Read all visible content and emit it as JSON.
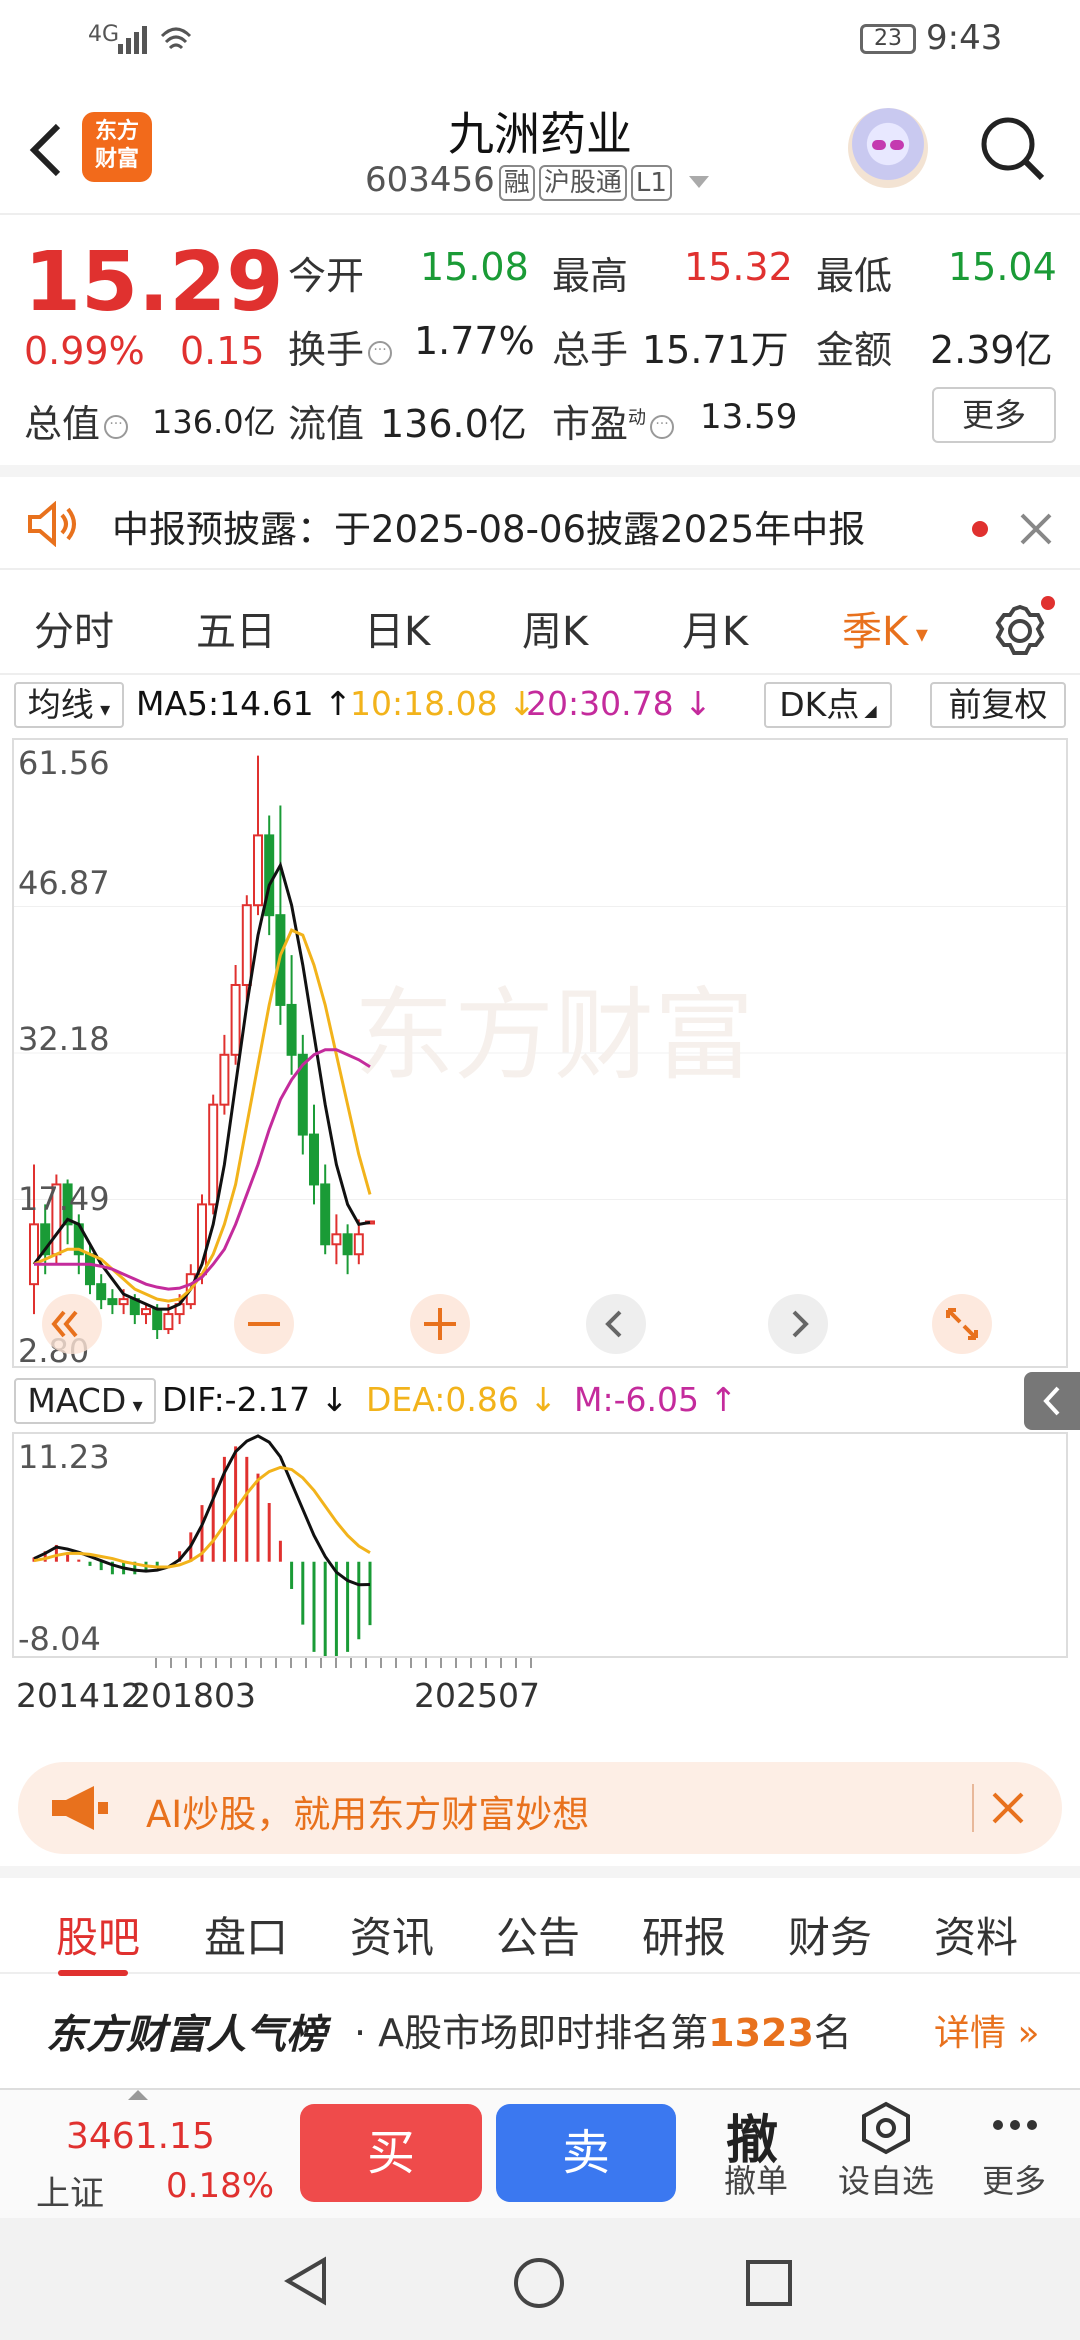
{
  "status": {
    "signal": "4G",
    "battery": "23",
    "time": "9:43"
  },
  "header": {
    "title": "九洲药业",
    "code": "603456",
    "tags": [
      "融",
      "沪股通",
      "L1"
    ],
    "logo_line1": "东方",
    "logo_line2": "财富"
  },
  "quote": {
    "price": "15.29",
    "pct": "0.99%",
    "change": "0.15",
    "open_label": "今开",
    "open": "15.08",
    "high_label": "最高",
    "high": "15.32",
    "low_label": "最低",
    "low": "15.04",
    "turnover_label": "换手",
    "turnover": "1.77%",
    "volume_label": "总手",
    "volume": "15.71万",
    "amount_label": "金额",
    "amount": "2.39亿",
    "mktcap_label": "总值",
    "mktcap": "136.0亿",
    "float_label": "流值",
    "float": "136.0亿",
    "pe_label": "市盈",
    "pe_sup": "动",
    "pe": "13.59",
    "more": "更多"
  },
  "notice": {
    "text": "中报预披露：于2025-08-06披露2025年中报"
  },
  "period_tabs": [
    "分时",
    "五日",
    "日K",
    "周K",
    "月K",
    "季K"
  ],
  "ma_row": {
    "indicator": "均线",
    "ma5": "MA5:14.61",
    "ma10": "10:18.08",
    "ma20": "20:30.78",
    "dk": "DK点",
    "adjust": "前复权"
  },
  "colors": {
    "up": "#e0312f",
    "down": "#1a9b36",
    "ma5": "#111111",
    "ma10": "#f2b31b",
    "ma20": "#c42b9c",
    "accent": "#e8711d"
  },
  "chart_data": [
    {
      "type": "candlestick",
      "title": "",
      "y_ticks": [
        "61.56",
        "46.87",
        "32.18",
        "17.49",
        "2.80"
      ],
      "ylim": [
        2.8,
        61.56
      ],
      "x_labels": [
        "201412",
        "201803",
        "202507"
      ],
      "series": [
        {
          "name": "MA5",
          "values": [
            11,
            12.5,
            14,
            15.5,
            15,
            13,
            11,
            9.5,
            8,
            7.5,
            7,
            6.5,
            6.5,
            7,
            8.5,
            11,
            15,
            21,
            29,
            37,
            44,
            49,
            51,
            47,
            41,
            34,
            27,
            21,
            17,
            15,
            15.2
          ]
        },
        {
          "name": "MA10",
          "values": [
            11,
            11.5,
            12,
            12.5,
            12.5,
            12,
            11.5,
            10.5,
            9.5,
            8.5,
            8,
            7.5,
            7.3,
            7.5,
            8.5,
            10,
            12,
            15,
            19,
            25,
            31,
            37,
            42,
            44.5,
            44,
            41,
            37,
            32,
            27,
            22,
            18
          ]
        },
        {
          "name": "MA20",
          "values": [
            11,
            11,
            11,
            11,
            11,
            11,
            10.8,
            10.5,
            10,
            9.5,
            9,
            8.7,
            8.5,
            8.6,
            9,
            9.7,
            11,
            12.5,
            15,
            18,
            21,
            24.5,
            27.5,
            29.5,
            31,
            32,
            32.5,
            32.5,
            32,
            31.5,
            30.8
          ]
        }
      ],
      "candles": [
        {
          "o": 9,
          "c": 15,
          "h": 21,
          "l": 6
        },
        {
          "o": 15,
          "c": 12,
          "h": 17,
          "l": 10
        },
        {
          "o": 12,
          "c": 19,
          "h": 20,
          "l": 11
        },
        {
          "o": 19,
          "c": 15,
          "h": 19.5,
          "l": 13
        },
        {
          "o": 15,
          "c": 12,
          "h": 16,
          "l": 10
        },
        {
          "o": 12,
          "c": 9,
          "h": 13,
          "l": 8
        },
        {
          "o": 9,
          "c": 7.5,
          "h": 10,
          "l": 6.5
        },
        {
          "o": 7.5,
          "c": 7,
          "h": 8.5,
          "l": 6
        },
        {
          "o": 7,
          "c": 7.5,
          "h": 8.5,
          "l": 6
        },
        {
          "o": 7.5,
          "c": 6,
          "h": 8,
          "l": 5
        },
        {
          "o": 6,
          "c": 6.5,
          "h": 7,
          "l": 5
        },
        {
          "o": 6.5,
          "c": 4.5,
          "h": 7,
          "l": 3.5
        },
        {
          "o": 4.5,
          "c": 6,
          "h": 7,
          "l": 4
        },
        {
          "o": 6,
          "c": 7,
          "h": 8,
          "l": 5
        },
        {
          "o": 7,
          "c": 10,
          "h": 11,
          "l": 6.5
        },
        {
          "o": 10,
          "c": 17,
          "h": 18,
          "l": 9
        },
        {
          "o": 17,
          "c": 27,
          "h": 28,
          "l": 16
        },
        {
          "o": 27,
          "c": 32,
          "h": 34,
          "l": 26
        },
        {
          "o": 32,
          "c": 39,
          "h": 41,
          "l": 31
        },
        {
          "o": 39,
          "c": 47,
          "h": 48,
          "l": 37
        },
        {
          "o": 47,
          "c": 54,
          "h": 62,
          "l": 46
        },
        {
          "o": 54,
          "c": 46,
          "h": 56,
          "l": 44
        },
        {
          "o": 46,
          "c": 37,
          "h": 57,
          "l": 35
        },
        {
          "o": 37,
          "c": 32,
          "h": 42,
          "l": 30
        },
        {
          "o": 32,
          "c": 24,
          "h": 34,
          "l": 22
        },
        {
          "o": 24,
          "c": 19,
          "h": 27,
          "l": 17
        },
        {
          "o": 19,
          "c": 13,
          "h": 21,
          "l": 12
        },
        {
          "o": 13,
          "c": 14,
          "h": 16,
          "l": 11
        },
        {
          "o": 14,
          "c": 12,
          "h": 15,
          "l": 10
        },
        {
          "o": 12,
          "c": 14,
          "h": 15.5,
          "l": 11
        },
        {
          "o": 15.08,
          "c": 15.29,
          "h": 15.32,
          "l": 15.04
        }
      ]
    },
    {
      "type": "bar",
      "title": "",
      "indicator": "MACD",
      "dif": "DIF:-2.17",
      "dea": "DEA:0.86",
      "m": "M:-6.05",
      "y_ticks": [
        "11.23",
        "-8.04"
      ],
      "ylim": [
        -8.04,
        11.23
      ],
      "series": [
        {
          "name": "DIF",
          "values": [
            0.3,
            0.8,
            1.4,
            1.2,
            0.9,
            0.5,
            0.1,
            -0.3,
            -0.6,
            -0.8,
            -0.9,
            -0.8,
            -0.5,
            0.2,
            1.5,
            3.5,
            6,
            8.5,
            10.5,
            11.5,
            12,
            11.4,
            10,
            7.5,
            5,
            2.5,
            0.5,
            -1,
            -1.8,
            -2.2,
            -2.17
          ]
        },
        {
          "name": "DEA",
          "values": [
            0.1,
            0.3,
            0.6,
            0.8,
            0.8,
            0.7,
            0.5,
            0.3,
            0,
            -0.2,
            -0.4,
            -0.5,
            -0.5,
            -0.3,
            0.1,
            0.8,
            2,
            3.5,
            5,
            6.5,
            7.8,
            8.6,
            9,
            8.8,
            8,
            6.8,
            5.3,
            3.8,
            2.5,
            1.5,
            0.86
          ]
        },
        {
          "name": "M",
          "values": [
            0.4,
            1,
            1.6,
            0.8,
            0.2,
            -0.4,
            -0.8,
            -1.2,
            -1.2,
            -1.2,
            -1,
            -0.6,
            0,
            1,
            2.8,
            5.4,
            8,
            10,
            11,
            10,
            8.4,
            5.6,
            2,
            -2.6,
            -6,
            -8.6,
            -9.6,
            -9.6,
            -8.6,
            -7.4,
            -6.05
          ]
        }
      ]
    }
  ],
  "ai_banner": {
    "text": "AI炒股，就用东方财富妙想"
  },
  "bottom_tabs": [
    "股吧",
    "盘口",
    "资讯",
    "公告",
    "研报",
    "财务",
    "资料"
  ],
  "rank": {
    "brand": "东方财富人气榜",
    "desc_prefix": "· A股市场即时排名第",
    "rank_no": "1323",
    "desc_suffix": "名",
    "detail": "详情"
  },
  "trade": {
    "index_value": "3461.15",
    "index_name": "上证",
    "index_pct": "0.18%",
    "buy": "买",
    "sell": "卖",
    "cancel_glyph": "撤",
    "cancel": "撤单",
    "watch": "设自选",
    "more": "更多"
  }
}
